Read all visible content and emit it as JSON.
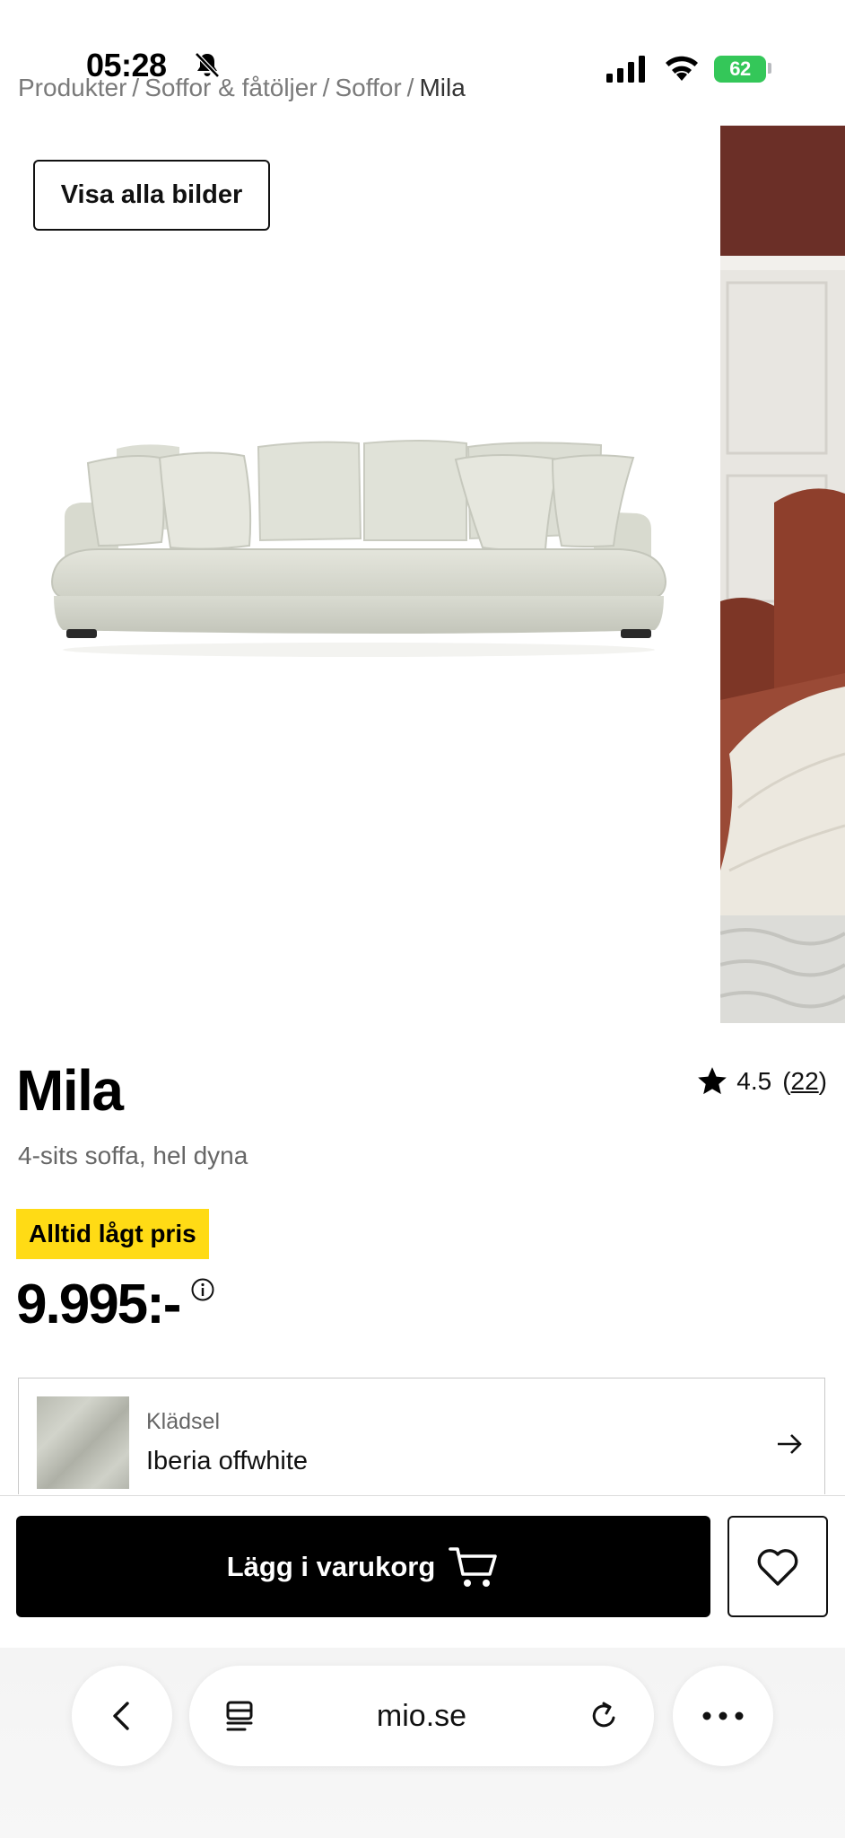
{
  "status_bar": {
    "time": "05:28",
    "battery": "62"
  },
  "breadcrumb": {
    "items": [
      "Produkter",
      "Soffor & fåtöljer",
      "Soffor"
    ],
    "current": "Mila",
    "separator": "/"
  },
  "gallery": {
    "show_all_label": "Visa alla bilder"
  },
  "product": {
    "title": "Mila",
    "subtitle": "4-sits soffa, hel dyna",
    "rating": "4.5",
    "review_count": "22",
    "badge": "Alltid lågt pris",
    "price": "9.995:-"
  },
  "upholstery": {
    "label": "Klädsel",
    "value": "Iberia offwhite"
  },
  "actions": {
    "add_to_cart_label": "Lägg i varukorg"
  },
  "browser": {
    "url": "mio.se"
  },
  "colors": {
    "badge": "#ffdb15",
    "primary_button": "#000000",
    "battery": "#34c759"
  },
  "icons": [
    "bell-slash-icon",
    "signal-icon",
    "wifi-icon",
    "star-icon",
    "info-icon",
    "arrow-right-icon",
    "cart-icon",
    "heart-icon",
    "chevron-left-icon",
    "reader-icon",
    "reload-icon",
    "more-icon"
  ]
}
